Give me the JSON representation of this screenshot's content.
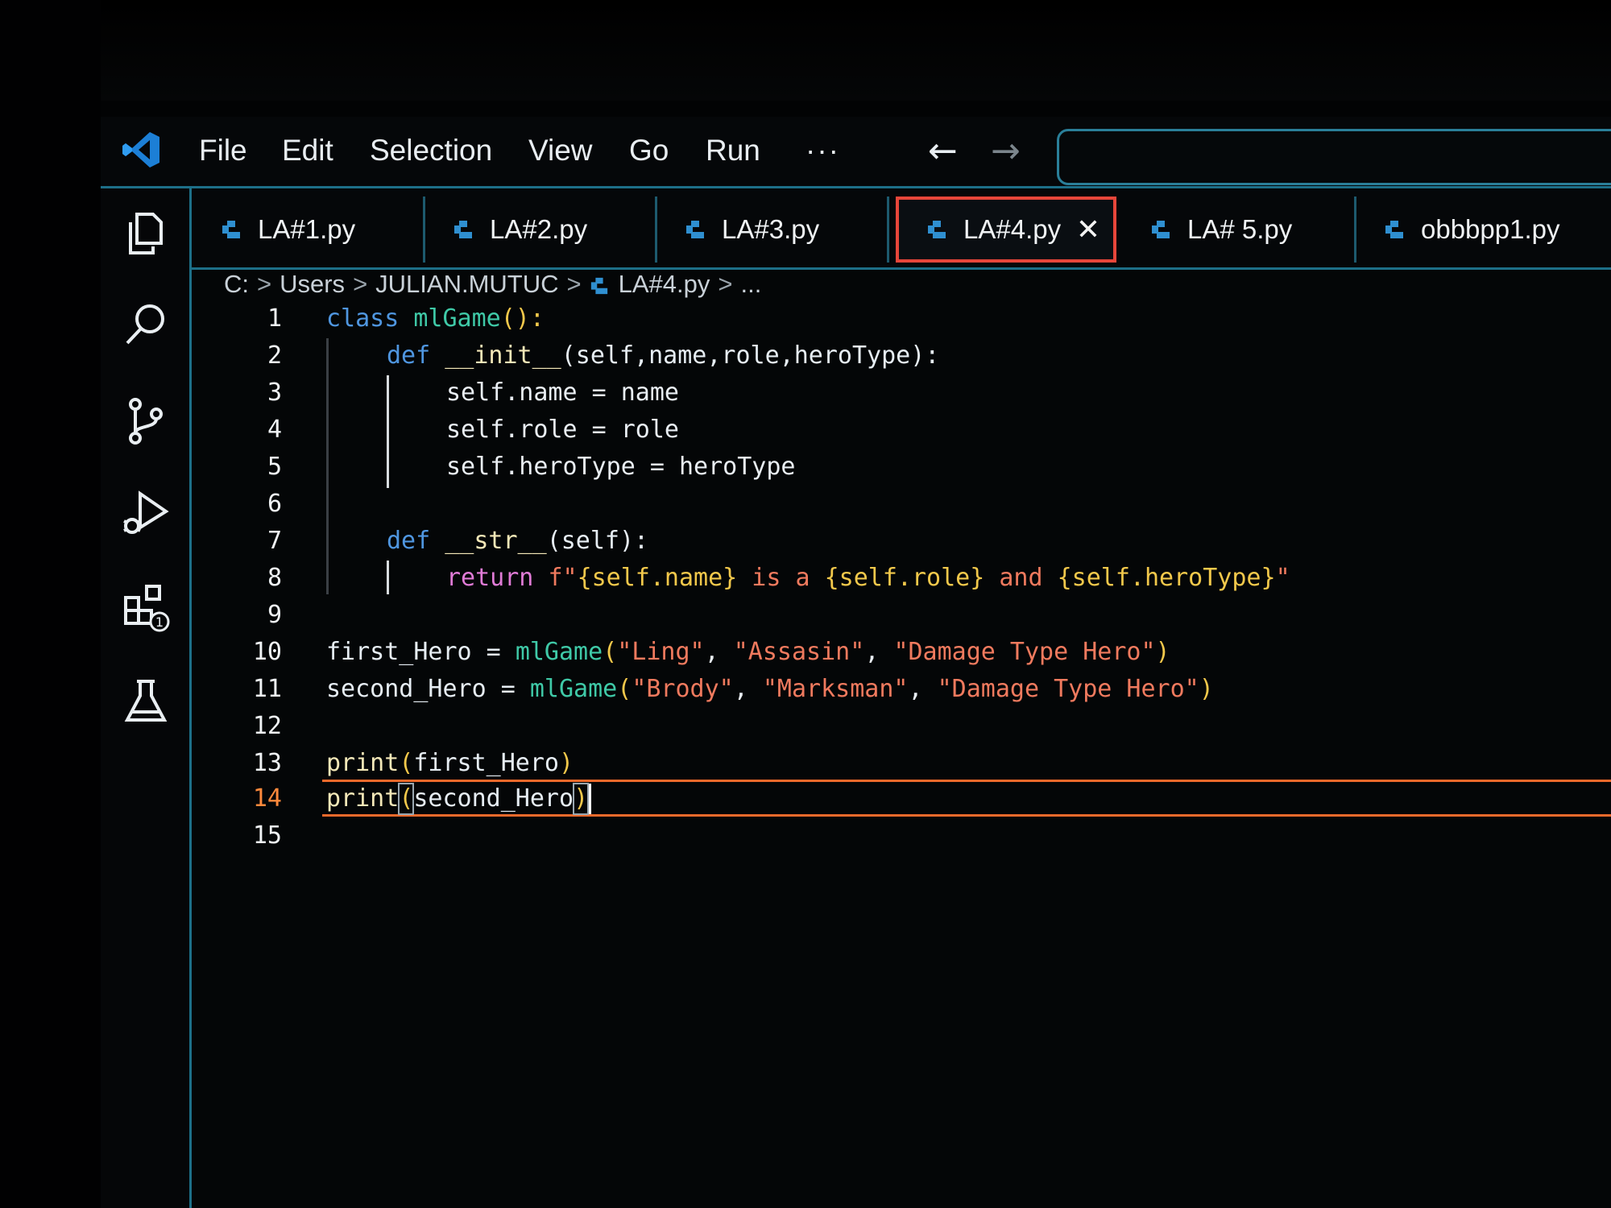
{
  "menu": {
    "items": [
      "File",
      "Edit",
      "Selection",
      "View",
      "Go",
      "Run",
      "···"
    ],
    "back_arrow": "←",
    "forward_arrow": "→"
  },
  "tabs": [
    {
      "label": "LA#1.py",
      "active": false
    },
    {
      "label": "LA#2.py",
      "active": false
    },
    {
      "label": "LA#3.py",
      "active": false
    },
    {
      "label": "LA#4.py",
      "active": true,
      "close": "✕"
    },
    {
      "label": "LA# 5.py",
      "active": false
    },
    {
      "label": "obbbpp1.py",
      "active": false
    }
  ],
  "breadcrumb": {
    "drive": "C:",
    "folder1": "Users",
    "folder2": "JULIAN.MUTUC",
    "file": "LA#4.py",
    "more": "..."
  },
  "editor": {
    "current_line": 14,
    "line_numbers": [
      "1",
      "2",
      "3",
      "4",
      "5",
      "6",
      "7",
      "8",
      "9",
      "10",
      "11",
      "12",
      "13",
      "14",
      "15"
    ],
    "lines": {
      "l1": {
        "kw": "class",
        "cls": "mlGame",
        "rest": "():"
      },
      "l2": {
        "kw": "def",
        "fn": "__init__",
        "params": "(self,name,role,heroType):"
      },
      "l3": "self.name = name",
      "l4": "self.role = role",
      "l5": "self.heroType = heroType",
      "l7": {
        "kw": "def",
        "fn": "__str__",
        "params": "(self):"
      },
      "l8": {
        "kw": "return",
        "prefix": "f\"",
        "p1": "{self.name}",
        "t1": " is a ",
        "p2": "{self.role}",
        "t2": " and ",
        "p3": "{self.heroType}",
        "suffix": "\""
      },
      "l10": {
        "var": "first_Hero",
        "op": " = ",
        "cls": "mlGame",
        "open": "(",
        "a1": "\"Ling\"",
        "a2": "\"Assasin\"",
        "a3": "\"Damage Type Hero\"",
        "close": ")"
      },
      "l11": {
        "var": "second_Hero",
        "op": " = ",
        "cls": "mlGame",
        "open": "(",
        "a1": "\"Brody\"",
        "a2": "\"Marksman\"",
        "a3": "\"Damage Type Hero\"",
        "close": ")"
      },
      "l13": {
        "fn": "print",
        "open": "(",
        "arg": "first_Hero",
        "close": ")"
      },
      "l14": {
        "fn": "print",
        "open": "(",
        "arg": "second_Hero",
        "close": ")"
      }
    }
  },
  "colors": {
    "accent_border": "#1d6f88",
    "active_tab_border": "#e7463a",
    "current_line_border": "#f06a2b",
    "keyword": "#4f96e0",
    "class_name": "#3fc9a7",
    "string": "#f07a5e"
  },
  "icons": [
    "vscode-logo-icon",
    "explorer-icon",
    "search-icon",
    "source-control-icon",
    "run-debug-icon",
    "extensions-icon",
    "testing-icon",
    "python-file-icon"
  ]
}
